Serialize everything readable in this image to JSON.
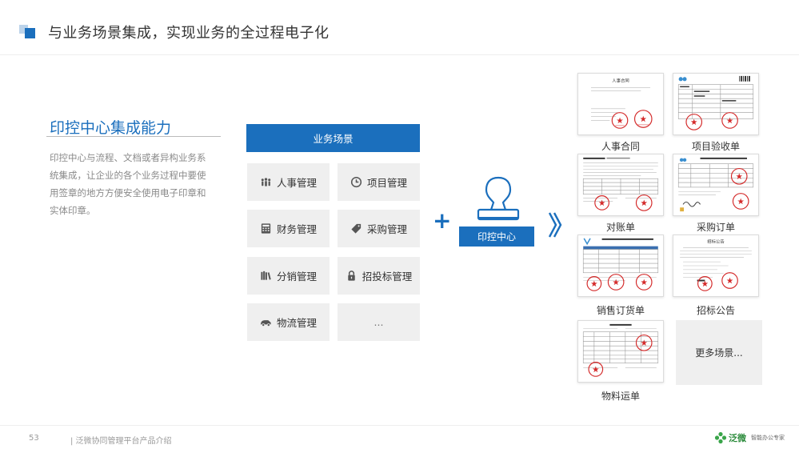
{
  "header": {
    "title": "与业务场景集成，实现业务的全过程电子化"
  },
  "left": {
    "title": "印控中心集成能力",
    "description": "印控中心与流程、文档或者异构业务系统集成，让企业的各个业务过程中要使用签章的地方方便安全使用电子印章和实体印章。"
  },
  "scenes": {
    "header": "业务场景",
    "items": [
      {
        "label": "人事管理",
        "icon": "people-icon"
      },
      {
        "label": "项目管理",
        "icon": "clock-icon"
      },
      {
        "label": "财务管理",
        "icon": "calculator-icon"
      },
      {
        "label": "采购管理",
        "icon": "tag-icon"
      },
      {
        "label": "分销管理",
        "icon": "books-icon"
      },
      {
        "label": "招投标管理",
        "icon": "lock-icon"
      },
      {
        "label": "物流管理",
        "icon": "truck-icon"
      },
      {
        "label": "...",
        "icon": ""
      }
    ]
  },
  "center": {
    "plus": "+",
    "stamp_label": "印控中心"
  },
  "documents": [
    {
      "caption": "人事合同",
      "doc_title": "人事合同"
    },
    {
      "caption": "项目验收单"
    },
    {
      "caption": "对账单"
    },
    {
      "caption": "采购订单"
    },
    {
      "caption": "销售订货单"
    },
    {
      "caption": "招标公告",
      "doc_title": "招标公告"
    },
    {
      "caption": "物料运单"
    }
  ],
  "more_scenes": "更多场景...",
  "footer": {
    "page": "53",
    "text": "| 泛微协同管理平台产品介绍",
    "logo_name": "泛微",
    "logo_slogan": "智能办公专家"
  },
  "colors": {
    "accent": "#1b6fbd",
    "stamp_red": "#d42a2a",
    "cell_bg": "#efefef"
  }
}
